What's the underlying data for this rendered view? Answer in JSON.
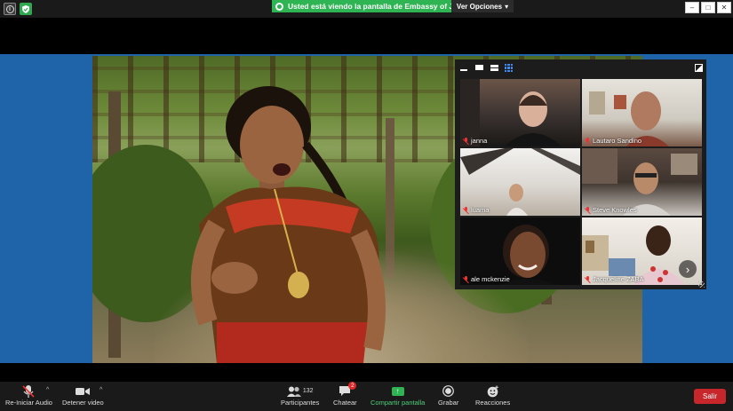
{
  "top_bar": {
    "share_banner": "Usted está viendo la pantalla de Embassy of Jamaica",
    "view_options": "Ver Opciones",
    "window_controls": [
      "–",
      "□",
      "✕"
    ]
  },
  "shared_screen": {
    "background_color": "#1f63a8"
  },
  "gallery": {
    "participants": [
      {
        "name": "janna",
        "muted": true
      },
      {
        "name": "Lautaro Sandino",
        "muted": true
      },
      {
        "name": "luama",
        "muted": true
      },
      {
        "name": "Steve Knowles",
        "muted": true
      },
      {
        "name": "ale mckenzie",
        "muted": true
      },
      {
        "name": "Jacqueline ZABA",
        "muted": true
      }
    ],
    "next_page_icon": "chevron-right-icon"
  },
  "toolbar": {
    "audio_label": "Re-Iniciar Audio",
    "video_label": "Detener video",
    "participants_label": "Participantes",
    "participants_count": "132",
    "chat_label": "Chatear",
    "chat_badge": "2",
    "share_label": "Compartir pantalla",
    "record_label": "Grabar",
    "reactions_label": "Reacciones",
    "leave_label": "Salir",
    "colors": {
      "leave": "#c7262b",
      "share": "#2fb453",
      "muted": "#e33333"
    }
  }
}
